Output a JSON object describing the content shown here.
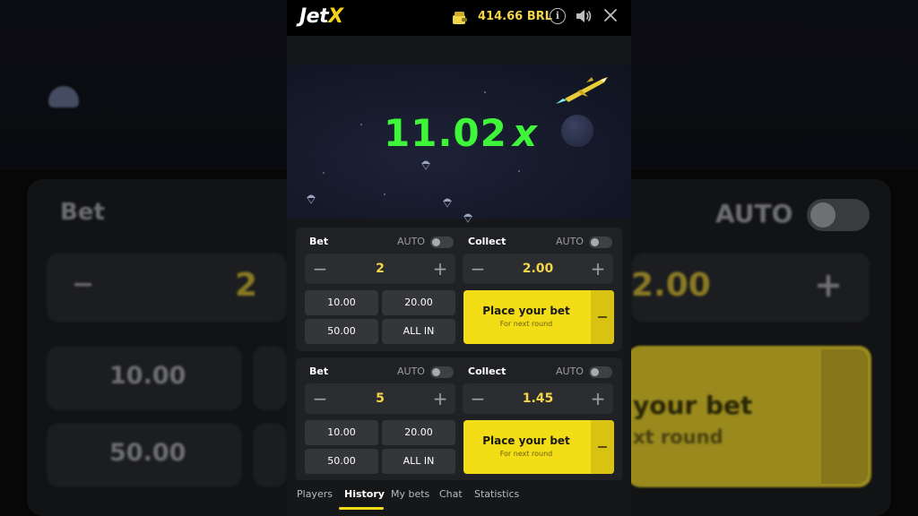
{
  "backdrop": {
    "bet_label": "Bet",
    "auto_label": "AUTO",
    "stake_value": "2",
    "collect_value": "2.00",
    "chip_a": "10.00",
    "chip_b": "50.00",
    "place_main_partial": "your bet",
    "place_sub_partial": "xt round"
  },
  "header": {
    "logo_main": "Jet",
    "logo_accent": "X",
    "balance": "414.66 BRL",
    "icons": [
      "wallet-icon",
      "info-icon",
      "sound-icon",
      "close-icon"
    ]
  },
  "game": {
    "multiplier": "11.02",
    "multiplier_suffix": "x"
  },
  "panels": [
    {
      "bet_label": "Bet",
      "auto_label": "AUTO",
      "stake": "2",
      "collect_label": "Collect",
      "collect_auto_label": "AUTO",
      "collect_value": "2.00",
      "chips": [
        "10.00",
        "20.00",
        "50.00",
        "ALL IN"
      ],
      "place_main": "Place your bet",
      "place_sub": "For next round"
    },
    {
      "bet_label": "Bet",
      "auto_label": "AUTO",
      "stake": "5",
      "collect_label": "Collect",
      "collect_auto_label": "AUTO",
      "collect_value": "1.45",
      "chips": [
        "10.00",
        "20.00",
        "50.00",
        "ALL IN"
      ],
      "place_main": "Place your bet",
      "place_sub": "For next round"
    }
  ],
  "tabs": [
    {
      "label": "Players"
    },
    {
      "label": "History",
      "active": true
    },
    {
      "label": "My bets"
    },
    {
      "label": "Chat"
    },
    {
      "label": "Statistics"
    }
  ],
  "symbols": {
    "minus": "−",
    "plus": "+"
  },
  "colors": {
    "accent_yellow": "#f3dd16",
    "balance_yellow": "#f3d54a",
    "multiplier_green": "#3ff53a",
    "panel_bg": "#202124"
  }
}
